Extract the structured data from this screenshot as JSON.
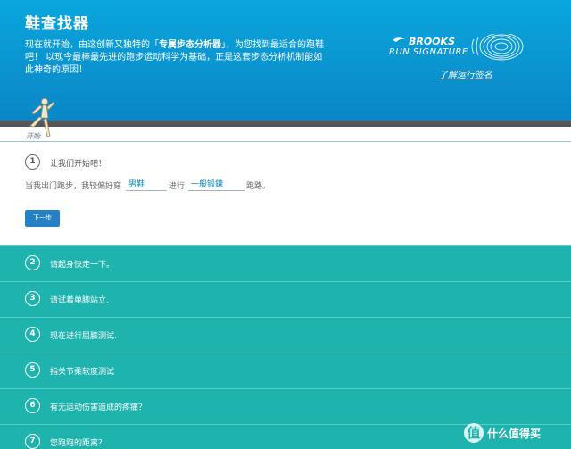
{
  "header": {
    "title": "鞋查找器",
    "desc_before": "现在就开始，由这创新又独特的「",
    "desc_highlight": "专属步态分析器",
    "desc_after": "」，为您找到最适合的跑鞋吧！ 以现今最棒最先进的跑步运动科学为基础，正是这套步态分析机制能如此神奇的原因！"
  },
  "logo": {
    "brand": "BROOKS",
    "subtitle": "RUN SIGNATURE",
    "link": "了解运行签名"
  },
  "progress": {
    "start_label": "开始"
  },
  "step1": {
    "number": "1",
    "title": "让我们开始吧！",
    "sentence_part1": "当我出门跑步，我较偏好穿",
    "select_gender": "男鞋",
    "sentence_part2": "进行",
    "select_run": "一般锻鍊",
    "sentence_part3": "跑路。",
    "next_button": "下一步"
  },
  "steps": [
    {
      "number": "2",
      "label": "请起身快走一下。"
    },
    {
      "number": "3",
      "label": "请试着单脚站立."
    },
    {
      "number": "4",
      "label": "现在进行屈膝测试."
    },
    {
      "number": "5",
      "label": "指关节柔软度测试"
    },
    {
      "number": "6",
      "label": "有无运动伤害造成的疼痛？"
    },
    {
      "number": "7",
      "label": "您跑跑的距离？"
    }
  ],
  "watermark": {
    "icon": "值",
    "text": "什么值得买"
  },
  "colors": {
    "header_blue": "#0aa6dd",
    "teal": "#1fb3ae",
    "button_blue": "#2580c4",
    "progress_gray": "#565656"
  }
}
